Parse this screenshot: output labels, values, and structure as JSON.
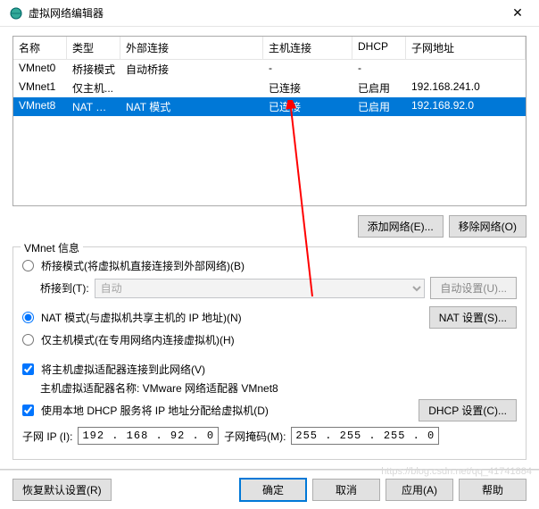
{
  "window": {
    "title": "虚拟网络编辑器"
  },
  "table": {
    "headers": {
      "name": "名称",
      "type": "类型",
      "ext": "外部连接",
      "host": "主机连接",
      "dhcp": "DHCP",
      "subnet": "子网地址"
    },
    "rows": [
      {
        "name": "VMnet0",
        "type": "桥接模式",
        "ext": "自动桥接",
        "host": "-",
        "dhcp": "-",
        "subnet": ""
      },
      {
        "name": "VMnet1",
        "type": "仅主机...",
        "ext": "",
        "host": "已连接",
        "dhcp": "已启用",
        "subnet": "192.168.241.0"
      },
      {
        "name": "VMnet8",
        "type": "NAT 模式",
        "ext": "NAT 模式",
        "host": "已连接",
        "dhcp": "已启用",
        "subnet": "192.168.92.0"
      }
    ]
  },
  "buttons": {
    "add_network": "添加网络(E)...",
    "remove_network": "移除网络(O)",
    "auto_bridge": "自动设置(U)...",
    "nat_settings": "NAT 设置(S)...",
    "dhcp_settings": "DHCP 设置(C)...",
    "restore": "恢复默认设置(R)",
    "ok": "确定",
    "cancel": "取消",
    "apply": "应用(A)",
    "help": "帮助"
  },
  "vmnet": {
    "group_title": "VMnet 信息",
    "bridge_radio": "桥接模式(将虚拟机直接连接到外部网络)(B)",
    "bridge_to_label": "桥接到(T):",
    "bridge_to_value": "自动",
    "nat_radio": "NAT 模式(与虚拟机共享主机的 IP 地址)(N)",
    "hostonly_radio": "仅主机模式(在专用网络内连接虚拟机)(H)",
    "host_adapter_check": "将主机虚拟适配器连接到此网络(V)",
    "host_adapter_name_label": "主机虚拟适配器名称: VMware 网络适配器 VMnet8",
    "dhcp_check": "使用本地 DHCP 服务将 IP 地址分配给虚拟机(D)"
  },
  "subnet": {
    "ip_label": "子网 IP (I):",
    "ip_value": "192 . 168 . 92 . 0",
    "mask_label": "子网掩码(M):",
    "mask_value": "255 . 255 . 255 . 0"
  },
  "watermark": "https://blog.csdn.net/qq_41741884"
}
